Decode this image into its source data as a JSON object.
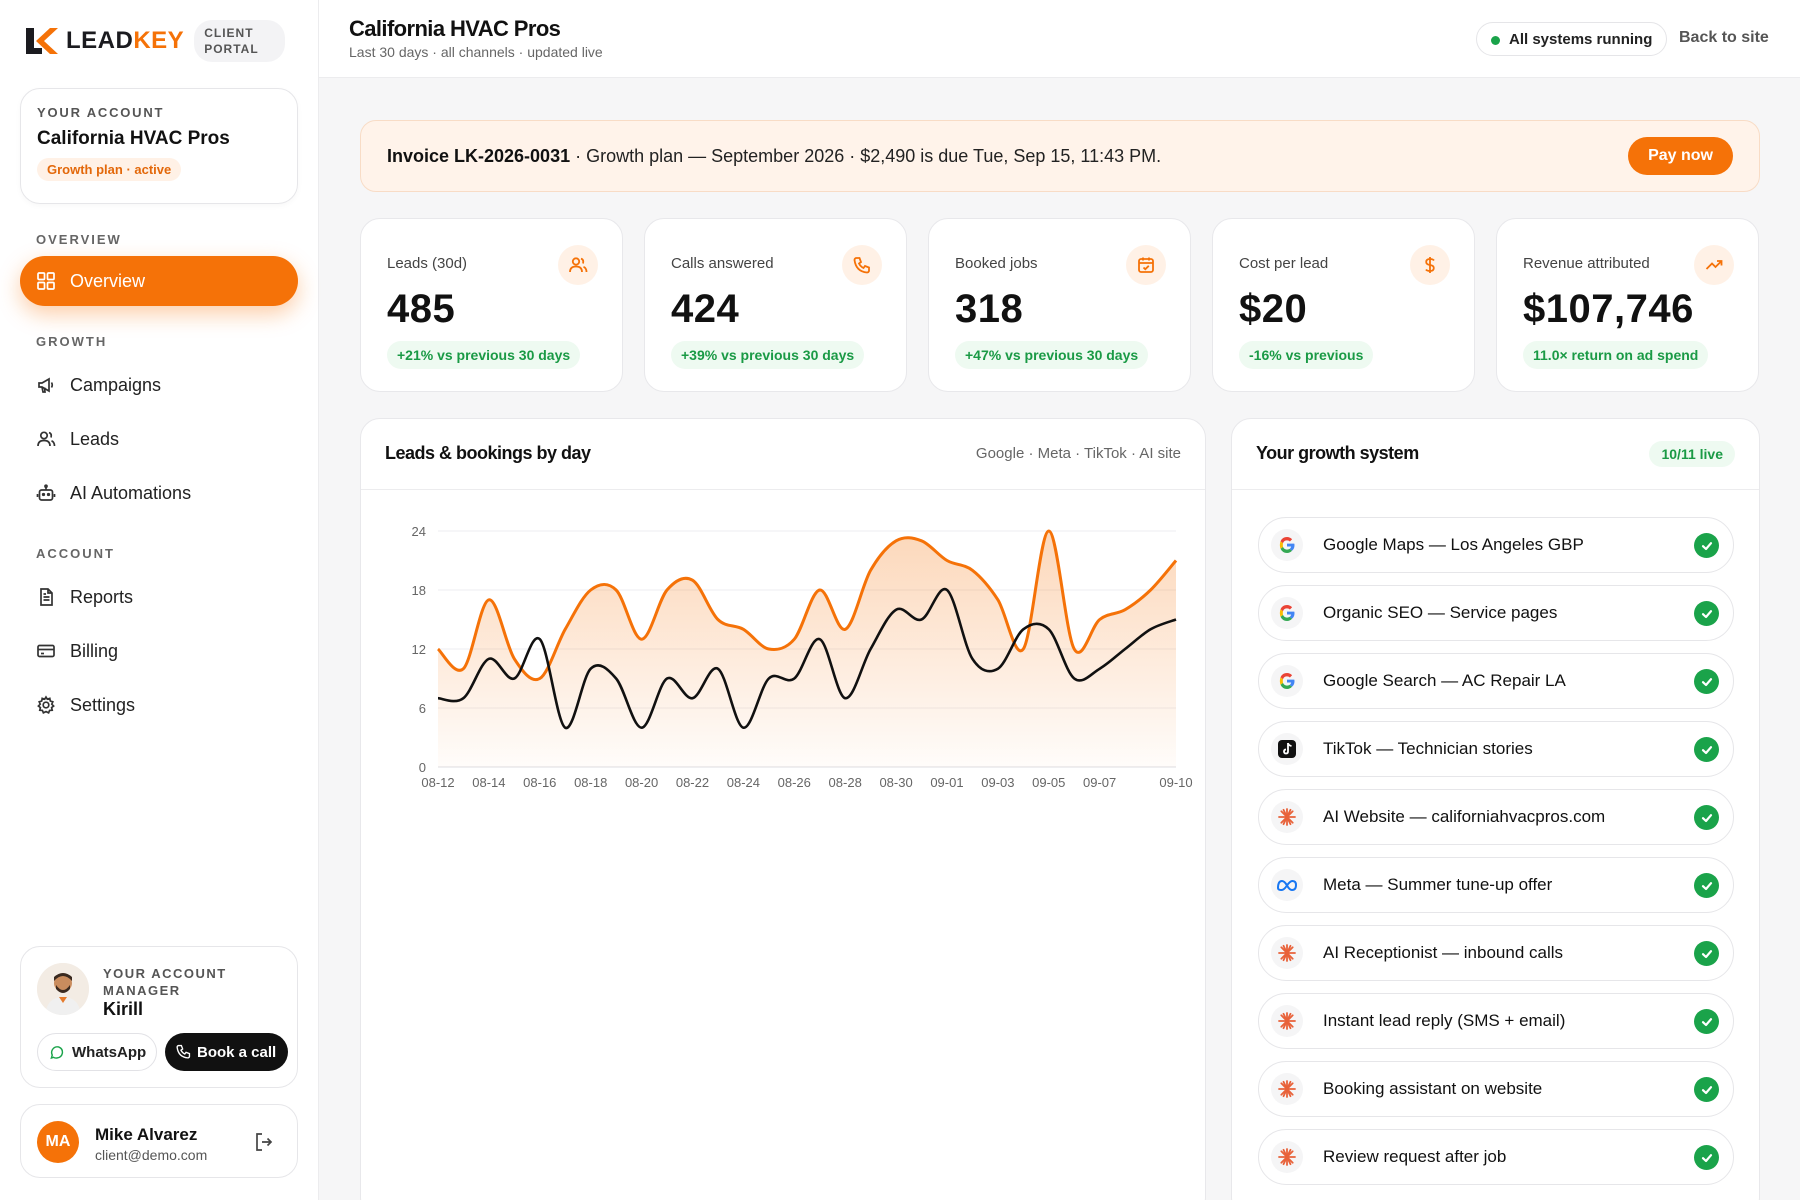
{
  "brand": {
    "word_left": "LEAD",
    "word_right": "KEY",
    "portal_line1": "CLIENT",
    "portal_line2": "PORTAL"
  },
  "account_card": {
    "label": "YOUR ACCOUNT",
    "name": "California HVAC Pros",
    "plan": "Growth plan · active"
  },
  "nav": {
    "overview_label": "OVERVIEW",
    "growth_label": "GROWTH",
    "account_label": "ACCOUNT",
    "items": [
      {
        "label": "Overview",
        "icon": "grid-icon",
        "active": true
      },
      {
        "label": "Campaigns",
        "icon": "megaphone-icon"
      },
      {
        "label": "Leads",
        "icon": "users-icon"
      },
      {
        "label": "AI Automations",
        "icon": "robot-icon"
      },
      {
        "label": "Reports",
        "icon": "document-icon"
      },
      {
        "label": "Billing",
        "icon": "credit-card-icon"
      },
      {
        "label": "Settings",
        "icon": "gear-icon"
      }
    ]
  },
  "manager": {
    "label": "YOUR ACCOUNT MANAGER",
    "name": "Kirill",
    "whatsapp_label": "WhatsApp",
    "call_label": "Book a call"
  },
  "user": {
    "initials": "MA",
    "name": "Mike Alvarez",
    "email": "client@demo.com"
  },
  "header": {
    "title": "California HVAC Pros",
    "subtitle": "Last 30 days · all channels · updated live",
    "status": "All systems running",
    "back_link": "Back to site"
  },
  "invoice": {
    "id": "Invoice LK-2026-0031",
    "text": " · Growth plan — September 2026 · $2,490 is due Tue, Sep 15, 11:43 PM.",
    "pay_label": "Pay now"
  },
  "kpis": [
    {
      "label": "Leads (30d)",
      "value": "485",
      "delta": "+21% vs previous 30 days",
      "icon": "users-icon"
    },
    {
      "label": "Calls answered",
      "value": "424",
      "delta": "+39% vs previous 30 days",
      "icon": "phone-icon"
    },
    {
      "label": "Booked jobs",
      "value": "318",
      "delta": "+47% vs previous 30 days",
      "icon": "calendar-check-icon"
    },
    {
      "label": "Cost per lead",
      "value": "$20",
      "delta": "-16% vs previous",
      "icon": "dollar-icon"
    },
    {
      "label": "Revenue attributed",
      "value": "$107,746",
      "delta": "11.0× return on ad spend",
      "icon": "trending-up-icon"
    }
  ],
  "chart_panel": {
    "title": "Leads & bookings by day",
    "legend": "Google · Meta · TikTok · AI site"
  },
  "chart_data": {
    "type": "area",
    "title": "Leads & bookings by day",
    "ylim": [
      0,
      24
    ],
    "yticks": [
      "0",
      "6",
      "12",
      "18",
      "24"
    ],
    "xtick_labels": [
      "08-12",
      "08-14",
      "08-16",
      "08-18",
      "08-20",
      "08-22",
      "08-24",
      "08-26",
      "08-28",
      "08-30",
      "09-01",
      "09-03",
      "09-05",
      "09-07",
      "09-10"
    ],
    "x": [
      "08-12",
      "08-13",
      "08-14",
      "08-15",
      "08-16",
      "08-17",
      "08-18",
      "08-19",
      "08-20",
      "08-21",
      "08-22",
      "08-23",
      "08-24",
      "08-25",
      "08-26",
      "08-27",
      "08-28",
      "08-29",
      "08-30",
      "08-31",
      "09-01",
      "09-02",
      "09-03",
      "09-04",
      "09-05",
      "09-06",
      "09-07",
      "09-08",
      "09-09",
      "09-10"
    ],
    "series": [
      {
        "values": [
          12,
          10,
          17,
          11,
          9,
          14,
          18,
          18,
          13,
          18,
          19,
          15,
          14,
          12,
          13,
          18,
          14,
          20,
          23,
          23,
          21,
          20,
          17,
          12,
          24,
          12,
          15,
          16,
          18,
          21
        ],
        "color": "#f57208"
      },
      {
        "values": [
          7,
          7,
          11,
          9,
          13,
          4,
          10,
          9,
          4,
          9,
          7,
          10,
          4,
          9,
          9,
          13,
          7,
          12,
          16,
          15,
          18,
          11,
          10,
          14,
          14,
          9,
          10,
          12,
          14,
          15
        ],
        "color": "#111111"
      }
    ]
  },
  "growth_panel": {
    "title": "Your growth system",
    "live": "10/11 live",
    "items": [
      {
        "label": "Google Maps — Los Angeles GBP",
        "icon": "google-icon"
      },
      {
        "label": "Organic SEO — Service pages",
        "icon": "google-icon"
      },
      {
        "label": "Google Search — AC Repair LA",
        "icon": "google-icon"
      },
      {
        "label": "TikTok — Technician stories",
        "icon": "tiktok-icon"
      },
      {
        "label": "AI Website — californiahvacpros.com",
        "icon": "ai-spark-icon"
      },
      {
        "label": "Meta — Summer tune-up offer",
        "icon": "meta-icon"
      },
      {
        "label": "AI Receptionist — inbound calls",
        "icon": "ai-spark-icon"
      },
      {
        "label": "Instant lead reply (SMS + email)",
        "icon": "ai-spark-icon"
      },
      {
        "label": "Booking assistant on website",
        "icon": "ai-spark-icon"
      },
      {
        "label": "Review request after job",
        "icon": "ai-spark-icon"
      }
    ]
  },
  "colors": {
    "accent": "#f57208",
    "success": "#1aa34a"
  }
}
